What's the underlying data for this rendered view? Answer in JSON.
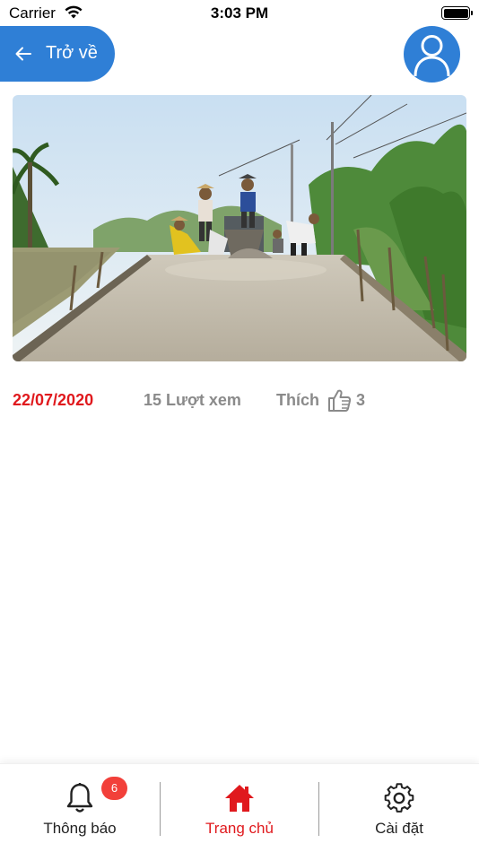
{
  "status_bar": {
    "carrier": "Carrier",
    "time": "3:03 PM"
  },
  "header": {
    "back_label": "Trở về"
  },
  "post": {
    "date": "22/07/2020",
    "views": "15 Lượt xem",
    "like_label": "Thích",
    "like_count": "3"
  },
  "tabs": {
    "items": [
      {
        "label": "Thông báo",
        "icon": "bell-icon",
        "badge": "6"
      },
      {
        "label": "Trang chủ",
        "icon": "home-icon",
        "active": true
      },
      {
        "label": "Cài đặt",
        "icon": "gear-icon"
      }
    ]
  },
  "colors": {
    "accent_blue": "#2f7fd6",
    "accent_red": "#e0191d",
    "badge_red": "#f2403a",
    "muted_text": "#8a8a8a"
  }
}
